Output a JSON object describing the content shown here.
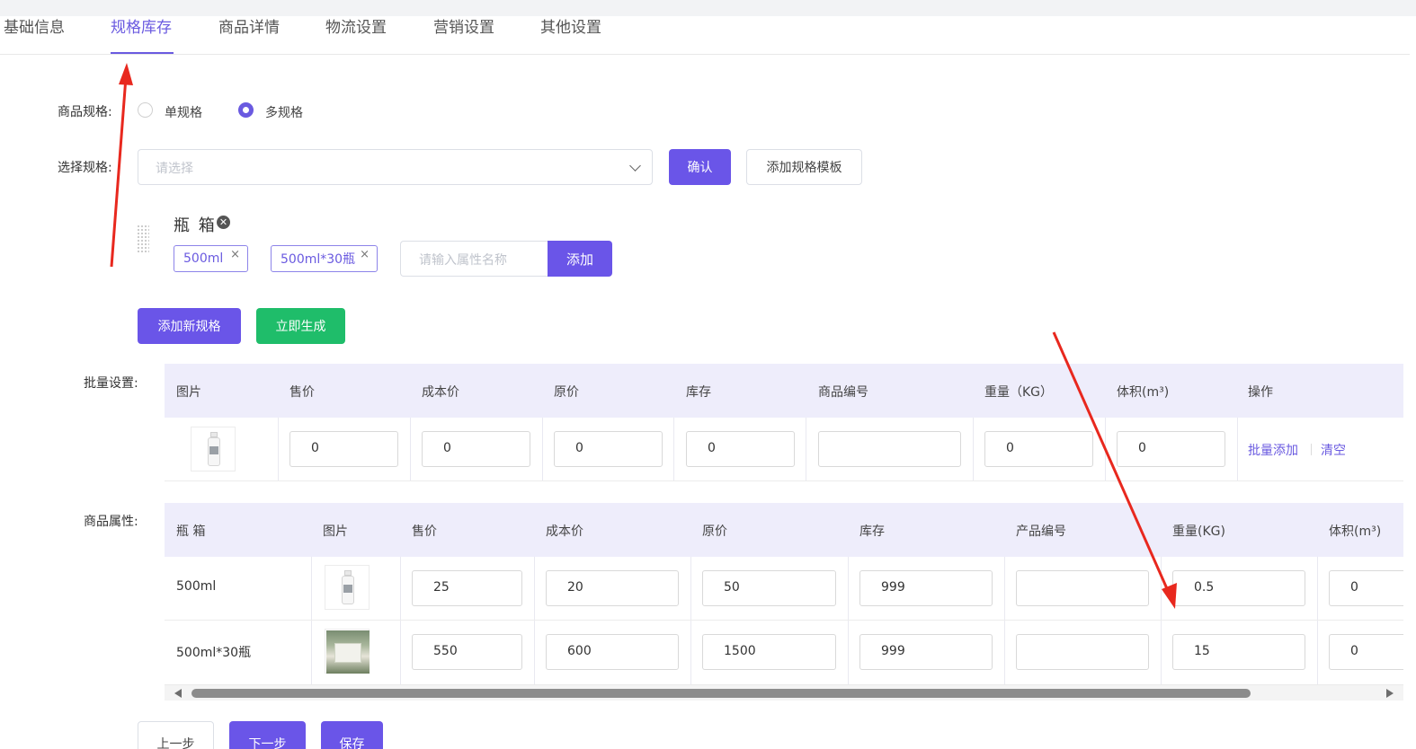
{
  "colors": {
    "primary": "#6a55e8",
    "green": "#1fbd6a",
    "annotation": "#e8281e",
    "header_bg": "#eeedfb"
  },
  "tabs": [
    {
      "label": "基础信息",
      "active": false
    },
    {
      "label": "规格库存",
      "active": true
    },
    {
      "label": "商品详情",
      "active": false
    },
    {
      "label": "物流设置",
      "active": false
    },
    {
      "label": "营销设置",
      "active": false
    },
    {
      "label": "其他设置",
      "active": false
    }
  ],
  "spec_type": {
    "label": "商品规格:",
    "options": [
      {
        "label": "单规格",
        "checked": false
      },
      {
        "label": "多规格",
        "checked": true
      }
    ]
  },
  "choose_spec": {
    "label": "选择规格:",
    "placeholder": "请选择",
    "confirm_label": "确认",
    "add_template_label": "添加规格模板"
  },
  "spec_group": {
    "name": "瓶 箱",
    "values": [
      "500ml",
      "500ml*30瓶"
    ],
    "attr_placeholder": "请输入属性名称",
    "add_label": "添加"
  },
  "actions": {
    "add_spec_label": "添加新规格",
    "generate_label": "立即生成"
  },
  "batch": {
    "label": "批量设置:",
    "headers": [
      "图片",
      "售价",
      "成本价",
      "原价",
      "库存",
      "商品编号",
      "重量（KG）",
      "体积(m³)",
      "操作"
    ],
    "values": {
      "price": "0",
      "cost": "0",
      "original": "0",
      "stock": "0",
      "code": "",
      "weight": "0",
      "volume": "0"
    },
    "batch_add_label": "批量添加",
    "clear_label": "清空"
  },
  "attrs": {
    "label": "商品属性:",
    "headers": [
      "瓶 箱",
      "图片",
      "售价",
      "成本价",
      "原价",
      "库存",
      "产品编号",
      "重量(KG)",
      "体积(m³)"
    ],
    "rows": [
      {
        "spec": "500ml",
        "price": "25",
        "cost": "20",
        "original": "50",
        "stock": "999",
        "code": "",
        "weight": "0.5",
        "volume": "0"
      },
      {
        "spec": "500ml*30瓶",
        "price": "550",
        "cost": "600",
        "original": "1500",
        "stock": "999",
        "code": "",
        "weight": "15",
        "volume": "0"
      }
    ]
  },
  "footer": {
    "prev_label": "上一步",
    "next_label": "下一步",
    "save_label": "保存"
  }
}
